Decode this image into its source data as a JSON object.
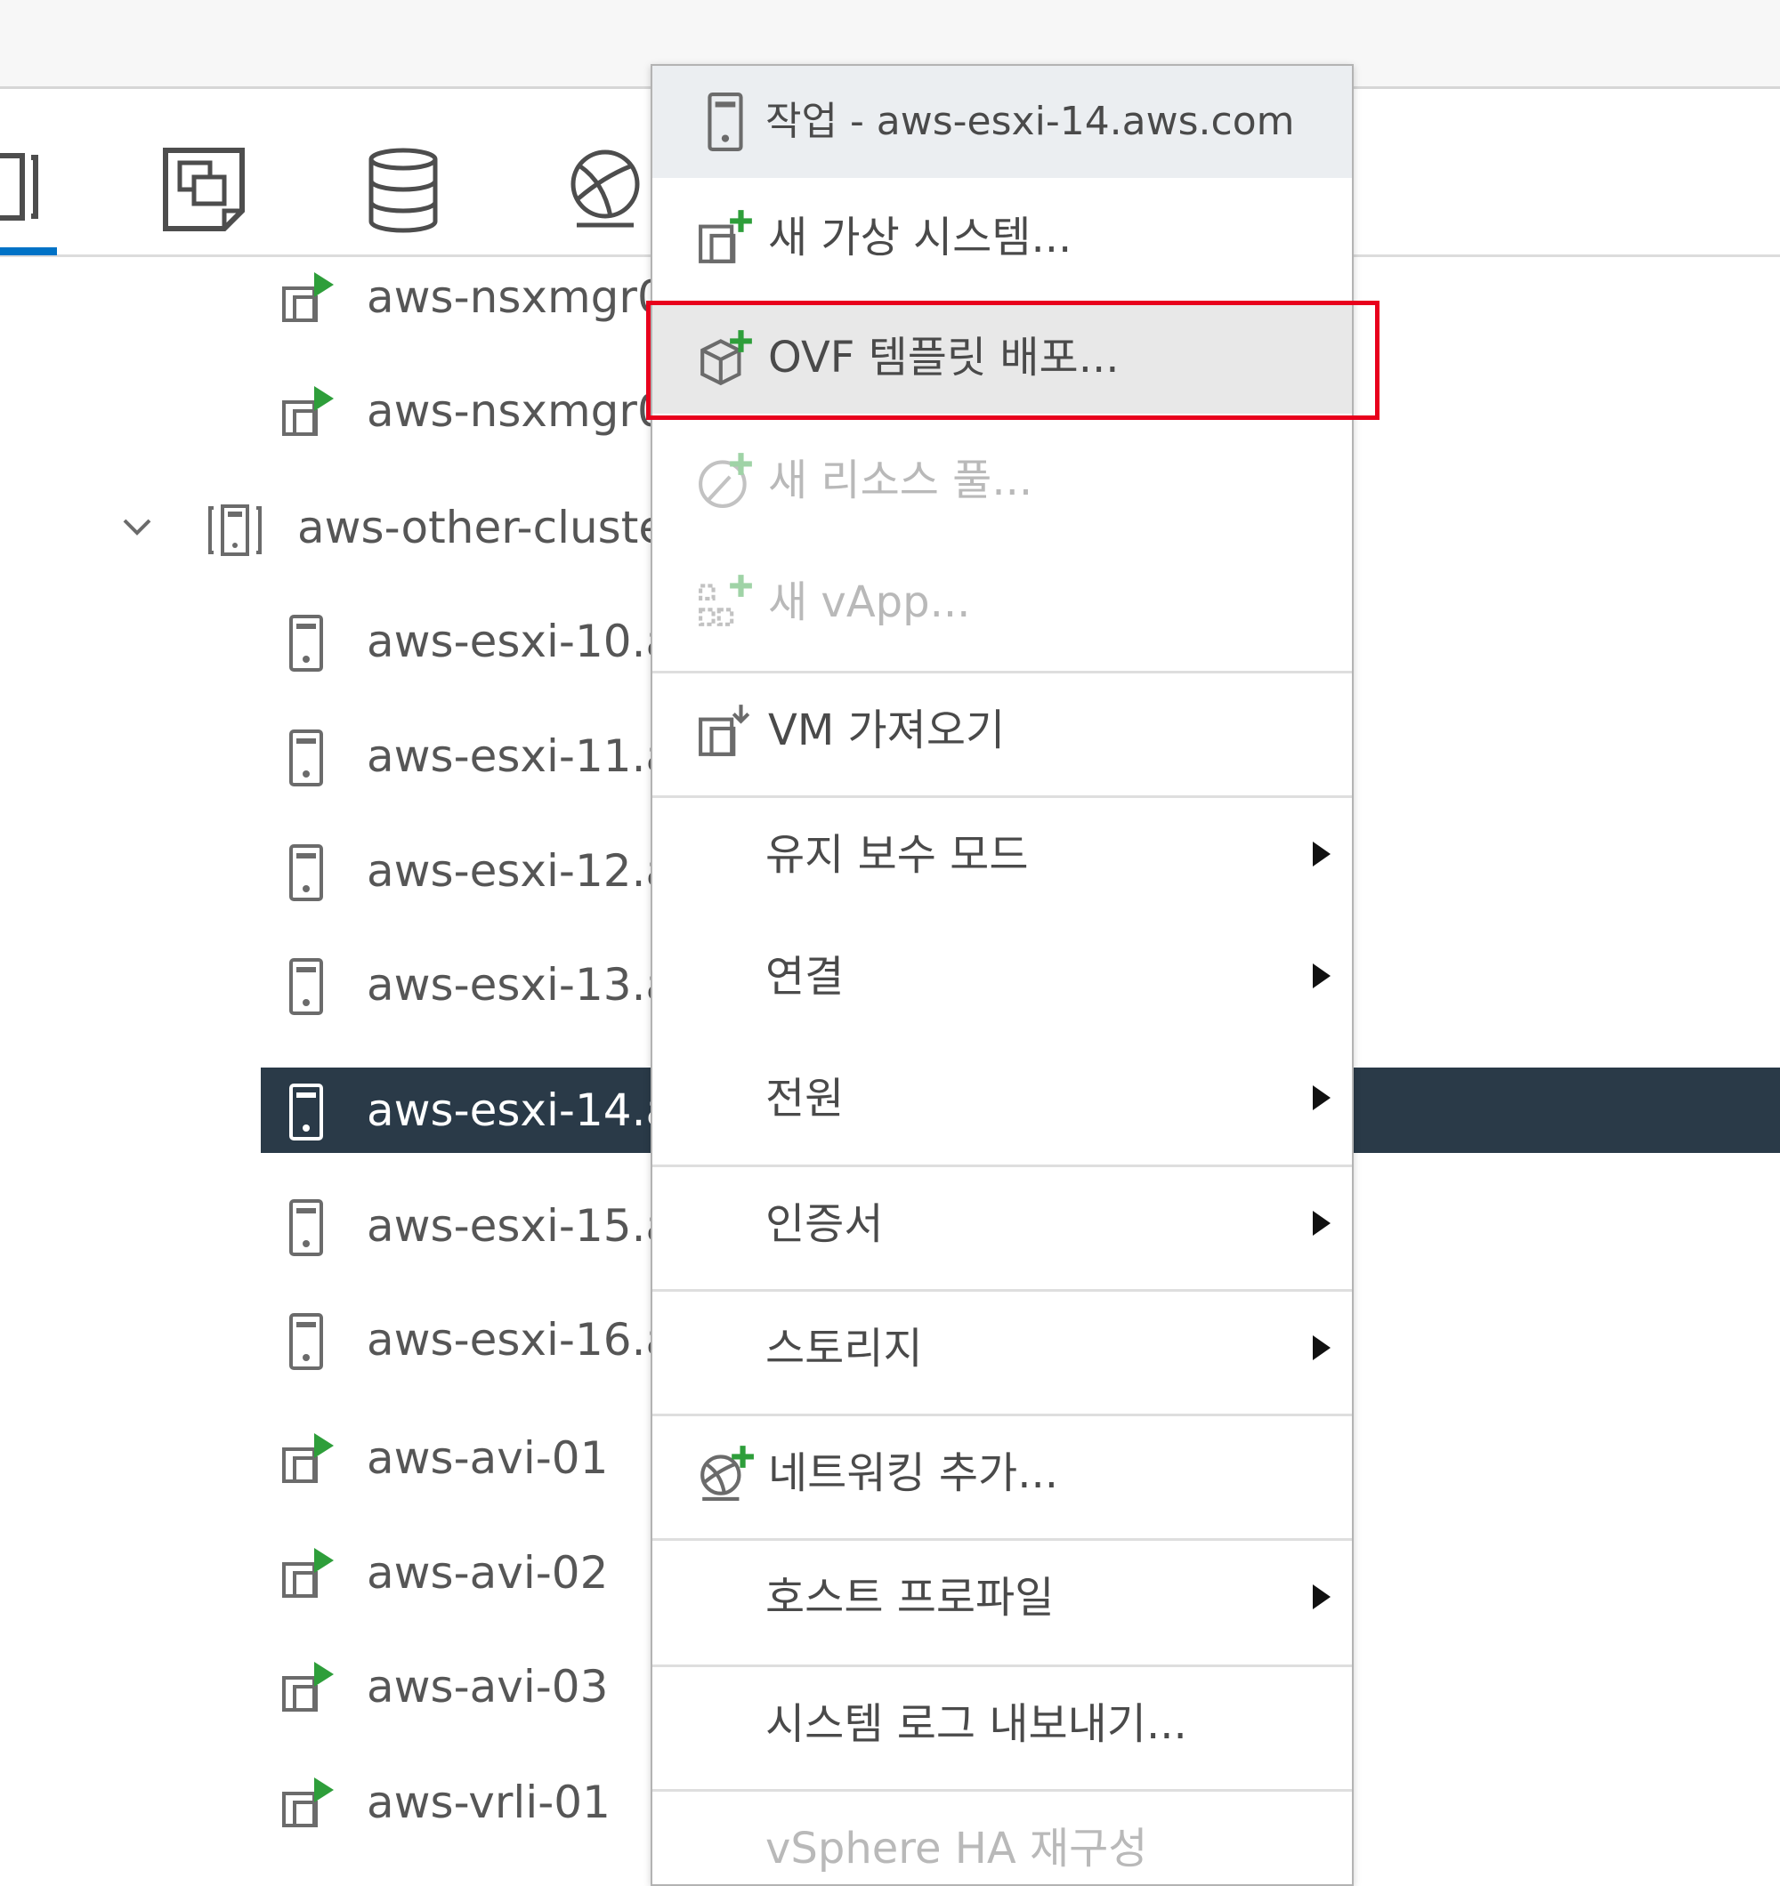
{
  "tree": {
    "items": [
      {
        "label": "aws-nsxmgr0",
        "icon": "vm-powered-on-icon"
      },
      {
        "label": "aws-nsxmgr0",
        "icon": "vm-powered-on-icon"
      },
      {
        "label": "aws-other-cluste",
        "icon": "cluster-icon"
      },
      {
        "label": "aws-esxi-10.a",
        "icon": "host-icon"
      },
      {
        "label": "aws-esxi-11.av",
        "icon": "host-icon"
      },
      {
        "label": "aws-esxi-12.a",
        "icon": "host-icon"
      },
      {
        "label": "aws-esxi-13.a",
        "icon": "host-icon"
      },
      {
        "label": "aws-esxi-14.a",
        "icon": "host-icon"
      },
      {
        "label": "aws-esxi-15.a",
        "icon": "host-icon"
      },
      {
        "label": "aws-esxi-16.a",
        "icon": "host-icon"
      },
      {
        "label": "aws-avi-01",
        "icon": "vm-powered-on-icon"
      },
      {
        "label": "aws-avi-02",
        "icon": "vm-powered-on-icon"
      },
      {
        "label": "aws-avi-03",
        "icon": "vm-powered-on-icon"
      },
      {
        "label": "aws-vrli-01",
        "icon": "vm-powered-on-icon"
      }
    ]
  },
  "tabs": [
    {
      "icon": "hosts-clusters-icon"
    },
    {
      "icon": "vms-templates-icon"
    },
    {
      "icon": "storage-icon"
    },
    {
      "icon": "networking-icon"
    }
  ],
  "menu": {
    "header": "작업 - aws-esxi-14.aws.com",
    "items": {
      "new_vm": "새 가상 시스템...",
      "deploy_ovf": "OVF 템플릿 배포...",
      "new_resource_pool": "새 리소스 풀...",
      "new_vapp": "새 vApp...",
      "import_vm": "VM 가져오기",
      "maintenance_mode": "유지 보수 모드",
      "connection": "연결",
      "power": "전원",
      "certificates": "인증서",
      "storage": "스토리지",
      "add_networking": "네트워킹 추가...",
      "host_profiles": "호스트 프로파일",
      "export_system_logs": "시스템 로그 내보내기...",
      "reconfigure_ha": "vSphere HA 재구성"
    }
  },
  "colors": {
    "selected_row": "#2a3a48",
    "highlight": "#e8001c",
    "accent": "#0072c6",
    "vm_green": "#2e9e3a"
  }
}
